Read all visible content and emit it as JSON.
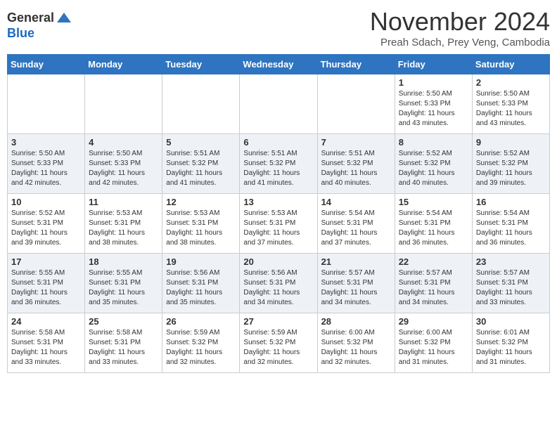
{
  "logo": {
    "general": "General",
    "blue": "Blue"
  },
  "title": "November 2024",
  "location": "Preah Sdach, Prey Veng, Cambodia",
  "days_of_week": [
    "Sunday",
    "Monday",
    "Tuesday",
    "Wednesday",
    "Thursday",
    "Friday",
    "Saturday"
  ],
  "weeks": [
    [
      {
        "day": "",
        "info": ""
      },
      {
        "day": "",
        "info": ""
      },
      {
        "day": "",
        "info": ""
      },
      {
        "day": "",
        "info": ""
      },
      {
        "day": "",
        "info": ""
      },
      {
        "day": "1",
        "info": "Sunrise: 5:50 AM\nSunset: 5:33 PM\nDaylight: 11 hours and 43 minutes."
      },
      {
        "day": "2",
        "info": "Sunrise: 5:50 AM\nSunset: 5:33 PM\nDaylight: 11 hours and 43 minutes."
      }
    ],
    [
      {
        "day": "3",
        "info": "Sunrise: 5:50 AM\nSunset: 5:33 PM\nDaylight: 11 hours and 42 minutes."
      },
      {
        "day": "4",
        "info": "Sunrise: 5:50 AM\nSunset: 5:33 PM\nDaylight: 11 hours and 42 minutes."
      },
      {
        "day": "5",
        "info": "Sunrise: 5:51 AM\nSunset: 5:32 PM\nDaylight: 11 hours and 41 minutes."
      },
      {
        "day": "6",
        "info": "Sunrise: 5:51 AM\nSunset: 5:32 PM\nDaylight: 11 hours and 41 minutes."
      },
      {
        "day": "7",
        "info": "Sunrise: 5:51 AM\nSunset: 5:32 PM\nDaylight: 11 hours and 40 minutes."
      },
      {
        "day": "8",
        "info": "Sunrise: 5:52 AM\nSunset: 5:32 PM\nDaylight: 11 hours and 40 minutes."
      },
      {
        "day": "9",
        "info": "Sunrise: 5:52 AM\nSunset: 5:32 PM\nDaylight: 11 hours and 39 minutes."
      }
    ],
    [
      {
        "day": "10",
        "info": "Sunrise: 5:52 AM\nSunset: 5:31 PM\nDaylight: 11 hours and 39 minutes."
      },
      {
        "day": "11",
        "info": "Sunrise: 5:53 AM\nSunset: 5:31 PM\nDaylight: 11 hours and 38 minutes."
      },
      {
        "day": "12",
        "info": "Sunrise: 5:53 AM\nSunset: 5:31 PM\nDaylight: 11 hours and 38 minutes."
      },
      {
        "day": "13",
        "info": "Sunrise: 5:53 AM\nSunset: 5:31 PM\nDaylight: 11 hours and 37 minutes."
      },
      {
        "day": "14",
        "info": "Sunrise: 5:54 AM\nSunset: 5:31 PM\nDaylight: 11 hours and 37 minutes."
      },
      {
        "day": "15",
        "info": "Sunrise: 5:54 AM\nSunset: 5:31 PM\nDaylight: 11 hours and 36 minutes."
      },
      {
        "day": "16",
        "info": "Sunrise: 5:54 AM\nSunset: 5:31 PM\nDaylight: 11 hours and 36 minutes."
      }
    ],
    [
      {
        "day": "17",
        "info": "Sunrise: 5:55 AM\nSunset: 5:31 PM\nDaylight: 11 hours and 36 minutes."
      },
      {
        "day": "18",
        "info": "Sunrise: 5:55 AM\nSunset: 5:31 PM\nDaylight: 11 hours and 35 minutes."
      },
      {
        "day": "19",
        "info": "Sunrise: 5:56 AM\nSunset: 5:31 PM\nDaylight: 11 hours and 35 minutes."
      },
      {
        "day": "20",
        "info": "Sunrise: 5:56 AM\nSunset: 5:31 PM\nDaylight: 11 hours and 34 minutes."
      },
      {
        "day": "21",
        "info": "Sunrise: 5:57 AM\nSunset: 5:31 PM\nDaylight: 11 hours and 34 minutes."
      },
      {
        "day": "22",
        "info": "Sunrise: 5:57 AM\nSunset: 5:31 PM\nDaylight: 11 hours and 34 minutes."
      },
      {
        "day": "23",
        "info": "Sunrise: 5:57 AM\nSunset: 5:31 PM\nDaylight: 11 hours and 33 minutes."
      }
    ],
    [
      {
        "day": "24",
        "info": "Sunrise: 5:58 AM\nSunset: 5:31 PM\nDaylight: 11 hours and 33 minutes."
      },
      {
        "day": "25",
        "info": "Sunrise: 5:58 AM\nSunset: 5:31 PM\nDaylight: 11 hours and 33 minutes."
      },
      {
        "day": "26",
        "info": "Sunrise: 5:59 AM\nSunset: 5:32 PM\nDaylight: 11 hours and 32 minutes."
      },
      {
        "day": "27",
        "info": "Sunrise: 5:59 AM\nSunset: 5:32 PM\nDaylight: 11 hours and 32 minutes."
      },
      {
        "day": "28",
        "info": "Sunrise: 6:00 AM\nSunset: 5:32 PM\nDaylight: 11 hours and 32 minutes."
      },
      {
        "day": "29",
        "info": "Sunrise: 6:00 AM\nSunset: 5:32 PM\nDaylight: 11 hours and 31 minutes."
      },
      {
        "day": "30",
        "info": "Sunrise: 6:01 AM\nSunset: 5:32 PM\nDaylight: 11 hours and 31 minutes."
      }
    ]
  ]
}
